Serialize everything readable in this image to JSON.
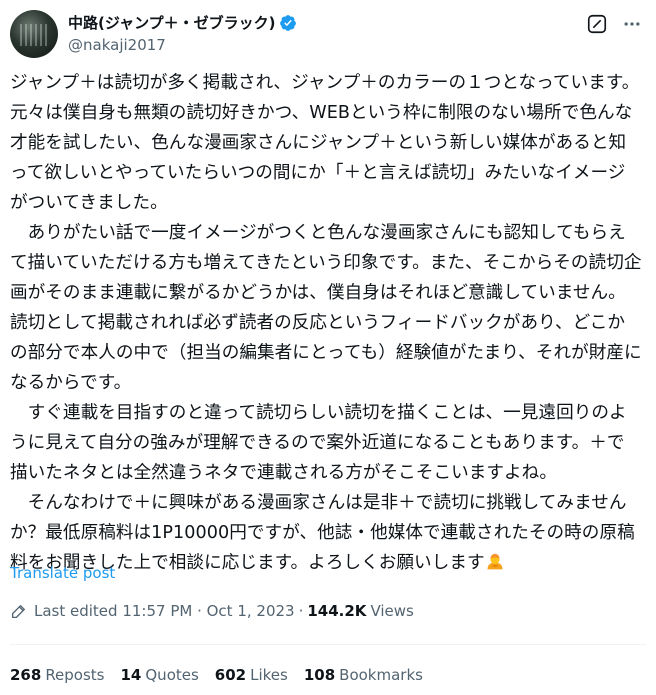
{
  "author": {
    "display_name": "中路(ジャンプ＋・ゼブラック)",
    "handle": "@nakaji2017",
    "verified": true
  },
  "post": {
    "text": "ジャンプ＋は読切が多く掲載され、ジャンプ＋のカラーの１つとなっています。元々は僕自身も無類の読切好きかつ、WEBという枠に制限のない場所で色んな才能を試したい、色んな漫画家さんにジャンプ＋という新しい媒体があると知って欲しいとやっていたらいつの間にか「＋と言えば読切」みたいなイメージがついてきました。\n　ありがたい話で一度イメージがつくと色んな漫画家さんにも認知してもらえて描いていただける方も増えてきたという印象です。また、そこからその読切企画がそのまま連載に繋がるかどうかは、僕自身はそれほど意識していません。読切として掲載されれば必ず読者の反応というフィードバックがあり、どこかの部分で本人の中で（担当の編集者にとっても）経験値がたまり、それが財産になるからです。\n　すぐ連載を目指すのと違って読切らしい読切を描くことは、一見遠回りのように見えて自分の強みが理解できるので案外近道になることもあります。＋で描いたネタとは全然違うネタで連載される方がそこそこいますよね。\n　そんなわけで＋に興味がある漫画家さんは是非＋で読切に挑戦してみませんか？最低原稿料は1P10000円ですが、他誌・他媒体で連載されたその時の原稿料をお聞きした上で相談に応じます。よろしくお願いします",
    "emoji": "person-bowing-emoji",
    "translate_label": "Translate post"
  },
  "meta": {
    "edited_label": "Last edited 11:57 PM · Oct 1, 2023",
    "separator": "·",
    "views_count": "144.2K",
    "views_label": "Views"
  },
  "stats": [
    {
      "count": "268",
      "label": "Reposts"
    },
    {
      "count": "14",
      "label": "Quotes"
    },
    {
      "count": "602",
      "label": "Likes"
    },
    {
      "count": "108",
      "label": "Bookmarks"
    }
  ],
  "icons": {
    "verified": "verified-badge-icon",
    "grok": "grok-icon",
    "more": "more-options-icon",
    "edit": "pencil-icon"
  },
  "colors": {
    "link": "#1d9bf0",
    "secondary_text": "#536471",
    "primary_text": "#0f1419",
    "divider": "#eff3f4"
  }
}
